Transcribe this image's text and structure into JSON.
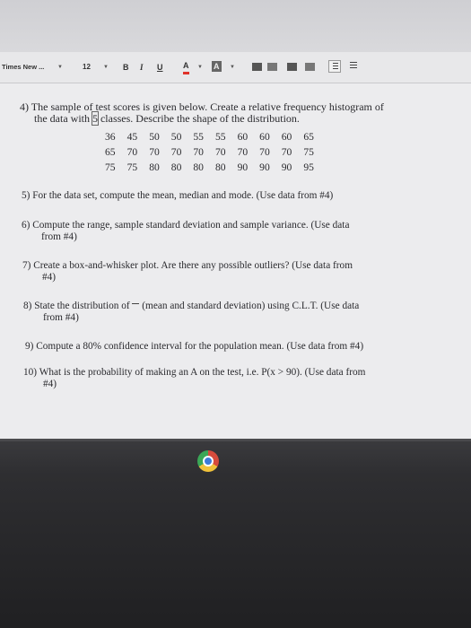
{
  "toolbar": {
    "font_name": "Times New ...",
    "font_size": "12",
    "bold": "B",
    "italic": "I",
    "underline": "U",
    "text_color": "A",
    "highlight": "A"
  },
  "questions": {
    "q4": {
      "number": "4)",
      "line1": "The sample of test scores is given below. Create a relative frequency histogram of",
      "line2a": "the data with ",
      "line2b": "5",
      "line2c": " classes. Describe the shape of the distribution.",
      "scores_row1": [
        "36",
        "45",
        "50",
        "50",
        "55",
        "55",
        "60",
        "60",
        "60",
        "65"
      ],
      "scores_row2": [
        "65",
        "70",
        "70",
        "70",
        "70",
        "70",
        "70",
        "70",
        "70",
        "75"
      ],
      "scores_row3": [
        "75",
        "75",
        "80",
        "80",
        "80",
        "80",
        "90",
        "90",
        "90",
        "95"
      ]
    },
    "q5": {
      "number": "5)",
      "text": "For the data set, compute the mean, median and mode. (Use data from #4)"
    },
    "q6": {
      "number": "6)",
      "line1": "Compute the range, sample standard deviation and sample variance. (Use data",
      "line2": "from #4)"
    },
    "q7": {
      "number": "7)",
      "line1": "Create a box-and-whisker plot. Are there any possible outliers? (Use data from",
      "line2": "#4)"
    },
    "q8": {
      "number": "8)",
      "line1a": "State the distribution of",
      "line1b": "(mean and standard deviation) using C.L.T. (Use data",
      "line2": "from #4)"
    },
    "q9": {
      "number": "9)",
      "text": "Compute a 80% confidence interval for the population mean. (Use data from #4)"
    },
    "q10": {
      "number": "10)",
      "line1": "What is the probability of making an A on the test, i.e. P(x > 90). (Use data from",
      "line2": "#4)"
    }
  },
  "colors": {
    "text_color_underline": "#e0322a",
    "dock": "#2e2e31"
  },
  "icons": [
    "dropdown-caret-icon",
    "align-left-icon",
    "align-center-icon",
    "align-right-icon",
    "justify-icon",
    "numbered-list-icon",
    "bulleted-list-icon",
    "chrome-icon"
  ]
}
